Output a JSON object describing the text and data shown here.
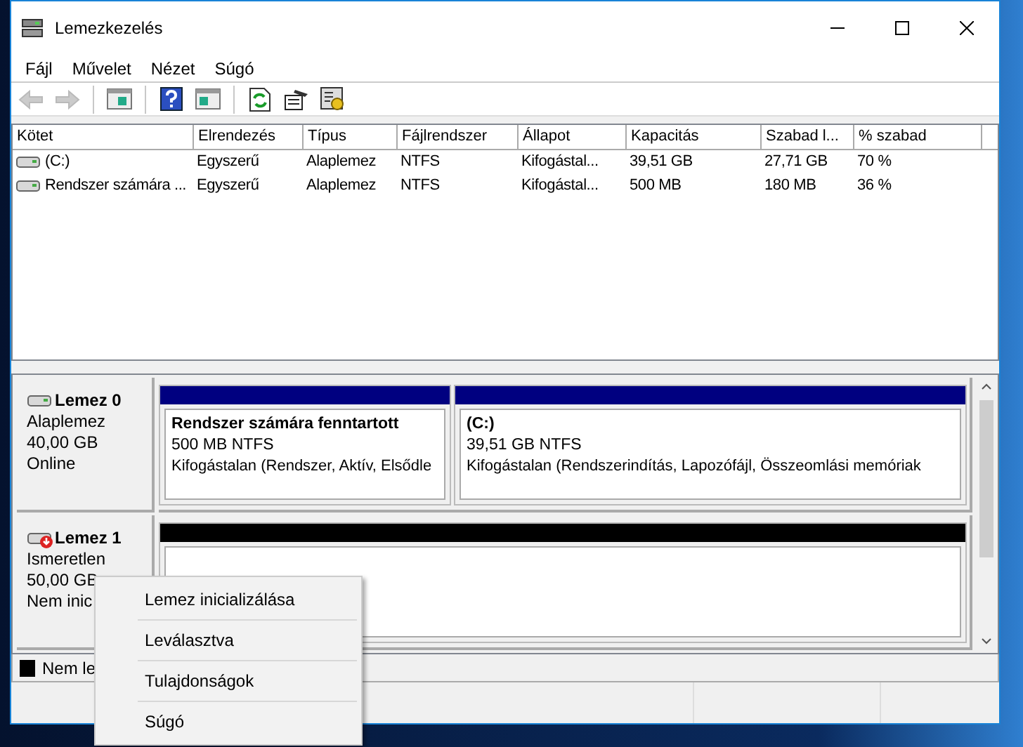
{
  "window": {
    "title": "Lemezkezelés"
  },
  "menu": [
    "Fájl",
    "Művelet",
    "Nézet",
    "Súgó"
  ],
  "toolbar": [
    {
      "kind": "back",
      "disabled": true
    },
    {
      "kind": "forward",
      "disabled": true
    },
    {
      "kind": "sep"
    },
    {
      "kind": "tree",
      "disabled": false
    },
    {
      "kind": "sep"
    },
    {
      "kind": "help",
      "disabled": false
    },
    {
      "kind": "pane",
      "disabled": false
    },
    {
      "kind": "sep"
    },
    {
      "kind": "refresh",
      "disabled": false
    },
    {
      "kind": "properties",
      "disabled": false
    },
    {
      "kind": "settings",
      "disabled": false
    }
  ],
  "volumes": {
    "columns": [
      "Kötet",
      "Elrendezés",
      "Típus",
      "Fájlrendszer",
      "Állapot",
      "Kapacitás",
      "Szabad l...",
      "% szabad"
    ],
    "rows": [
      {
        "cells": [
          "(C:)",
          "Egyszerű",
          "Alaplemez",
          "NTFS",
          "Kifogástal...",
          "39,51 GB",
          "27,71 GB",
          "70 %"
        ]
      },
      {
        "cells": [
          "Rendszer számára ...",
          "Egyszerű",
          "Alaplemez",
          "NTFS",
          "Kifogástal...",
          "500 MB",
          "180 MB",
          "36 %"
        ]
      }
    ]
  },
  "disks": [
    {
      "name": "Lemez 0",
      "kind": "online",
      "type": "Alaplemez",
      "size": "40,00 GB",
      "status": "Online",
      "partitions": [
        {
          "kind": "primary",
          "title": "Rendszer számára fenntartott",
          "detail": "500 MB NTFS",
          "status": "Kifogástalan (Rendszer, Aktív, Elsődle"
        },
        {
          "kind": "primary",
          "title": "(C:)",
          "detail": "39,51 GB NTFS",
          "status": "Kifogástalan (Rendszerindítás, Lapozófájl, Összeomlási memóriak"
        }
      ]
    },
    {
      "name": "Lemez 1",
      "kind": "uninitialized",
      "type": "Ismeretlen",
      "size": "50,00 GB",
      "status": "Nem inic",
      "partitions": [
        {
          "kind": "unallocated"
        }
      ]
    }
  ],
  "legend": [
    {
      "label": "Nem le",
      "color": "#000000"
    }
  ],
  "context_menu": [
    "Lemez inicializálása",
    "Leválasztva",
    "Tulajdonságok",
    "Súgó"
  ]
}
